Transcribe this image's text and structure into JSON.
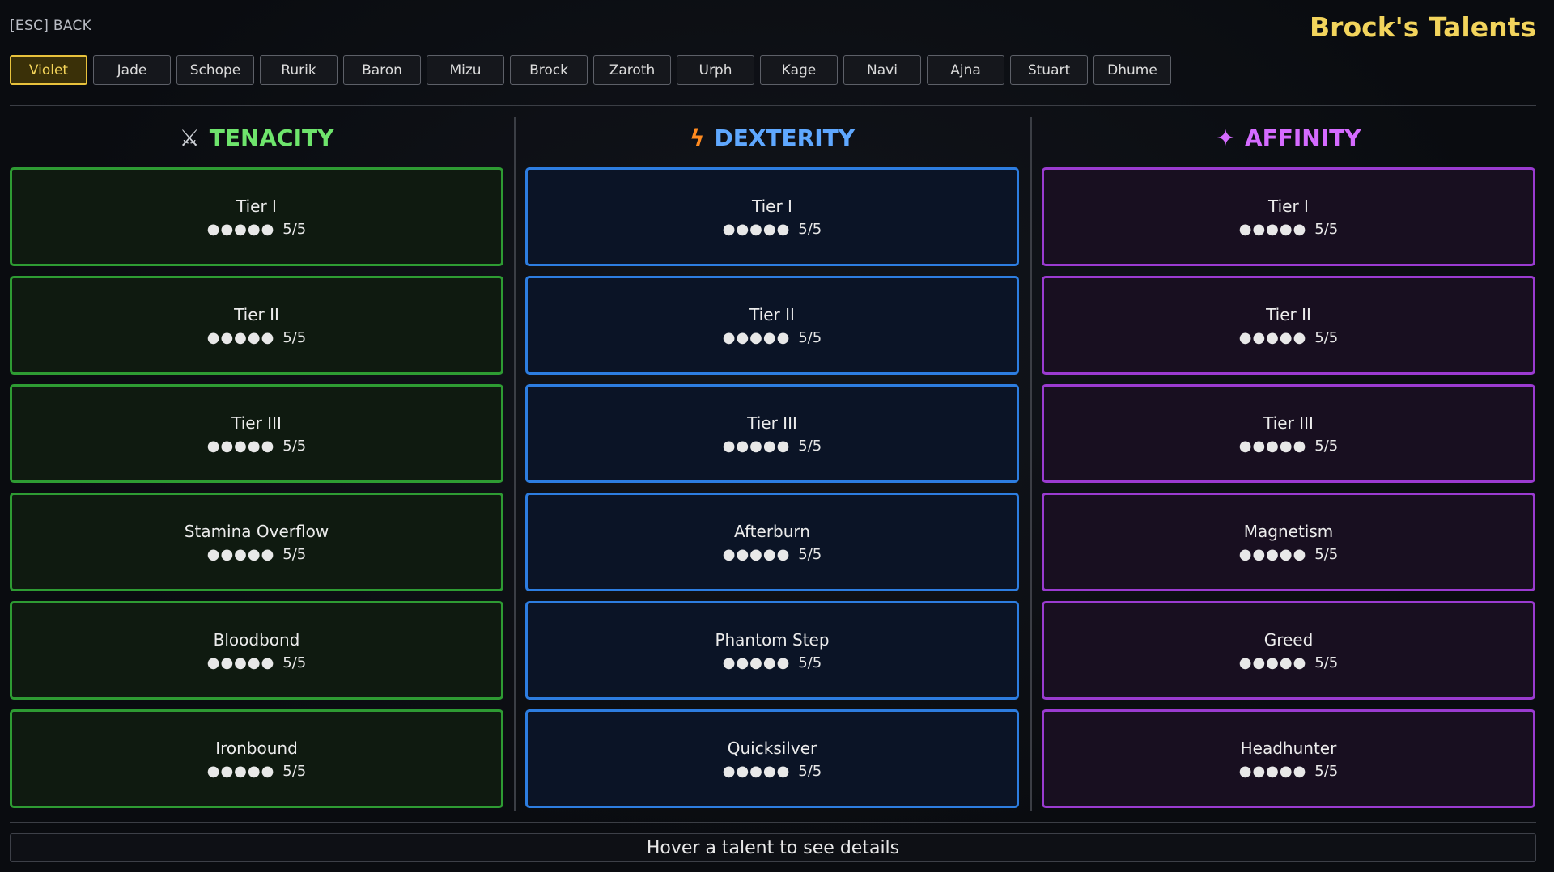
{
  "back_label": "[ESC] BACK",
  "title": "Brock's Talents",
  "characters": [
    "Violet",
    "Jade",
    "Schope",
    "Rurik",
    "Baron",
    "Mizu",
    "Brock",
    "Zaroth",
    "Urph",
    "Kage",
    "Navi",
    "Ajna",
    "Stuart",
    "Dhume"
  ],
  "active_character": "Violet",
  "columns": [
    {
      "key": "tenacity",
      "name": "TENACITY",
      "icon": "crossed-swords-icon",
      "icon_glyph": "⚔",
      "color": "#6ee46c",
      "talents": [
        {
          "name": "Tier I",
          "dots": "●●●●●",
          "rank": "5/5"
        },
        {
          "name": "Tier II",
          "dots": "●●●●●",
          "rank": "5/5"
        },
        {
          "name": "Tier III",
          "dots": "●●●●●",
          "rank": "5/5"
        },
        {
          "name": "Stamina Overflow",
          "dots": "●●●●●",
          "rank": "5/5"
        },
        {
          "name": "Bloodbond",
          "dots": "●●●●●",
          "rank": "5/5"
        },
        {
          "name": "Ironbound",
          "dots": "●●●●●",
          "rank": "5/5"
        }
      ]
    },
    {
      "key": "dexterity",
      "name": "DEXTERITY",
      "icon": "lightning-bolt-icon",
      "icon_glyph": "ϟ",
      "color": "#5fa8ff",
      "talents": [
        {
          "name": "Tier I",
          "dots": "●●●●●",
          "rank": "5/5"
        },
        {
          "name": "Tier II",
          "dots": "●●●●●",
          "rank": "5/5"
        },
        {
          "name": "Tier III",
          "dots": "●●●●●",
          "rank": "5/5"
        },
        {
          "name": "Afterburn",
          "dots": "●●●●●",
          "rank": "5/5"
        },
        {
          "name": "Phantom Step",
          "dots": "●●●●●",
          "rank": "5/5"
        },
        {
          "name": "Quicksilver",
          "dots": "●●●●●",
          "rank": "5/5"
        }
      ]
    },
    {
      "key": "affinity",
      "name": "AFFINITY",
      "icon": "sparkle-icon",
      "icon_glyph": "✦",
      "color": "#d56bff",
      "talents": [
        {
          "name": "Tier I",
          "dots": "●●●●●",
          "rank": "5/5"
        },
        {
          "name": "Tier II",
          "dots": "●●●●●",
          "rank": "5/5"
        },
        {
          "name": "Tier III",
          "dots": "●●●●●",
          "rank": "5/5"
        },
        {
          "name": "Magnetism",
          "dots": "●●●●●",
          "rank": "5/5"
        },
        {
          "name": "Greed",
          "dots": "●●●●●",
          "rank": "5/5"
        },
        {
          "name": "Headhunter",
          "dots": "●●●●●",
          "rank": "5/5"
        }
      ]
    }
  ],
  "detail_text": "Hover a talent to see details"
}
